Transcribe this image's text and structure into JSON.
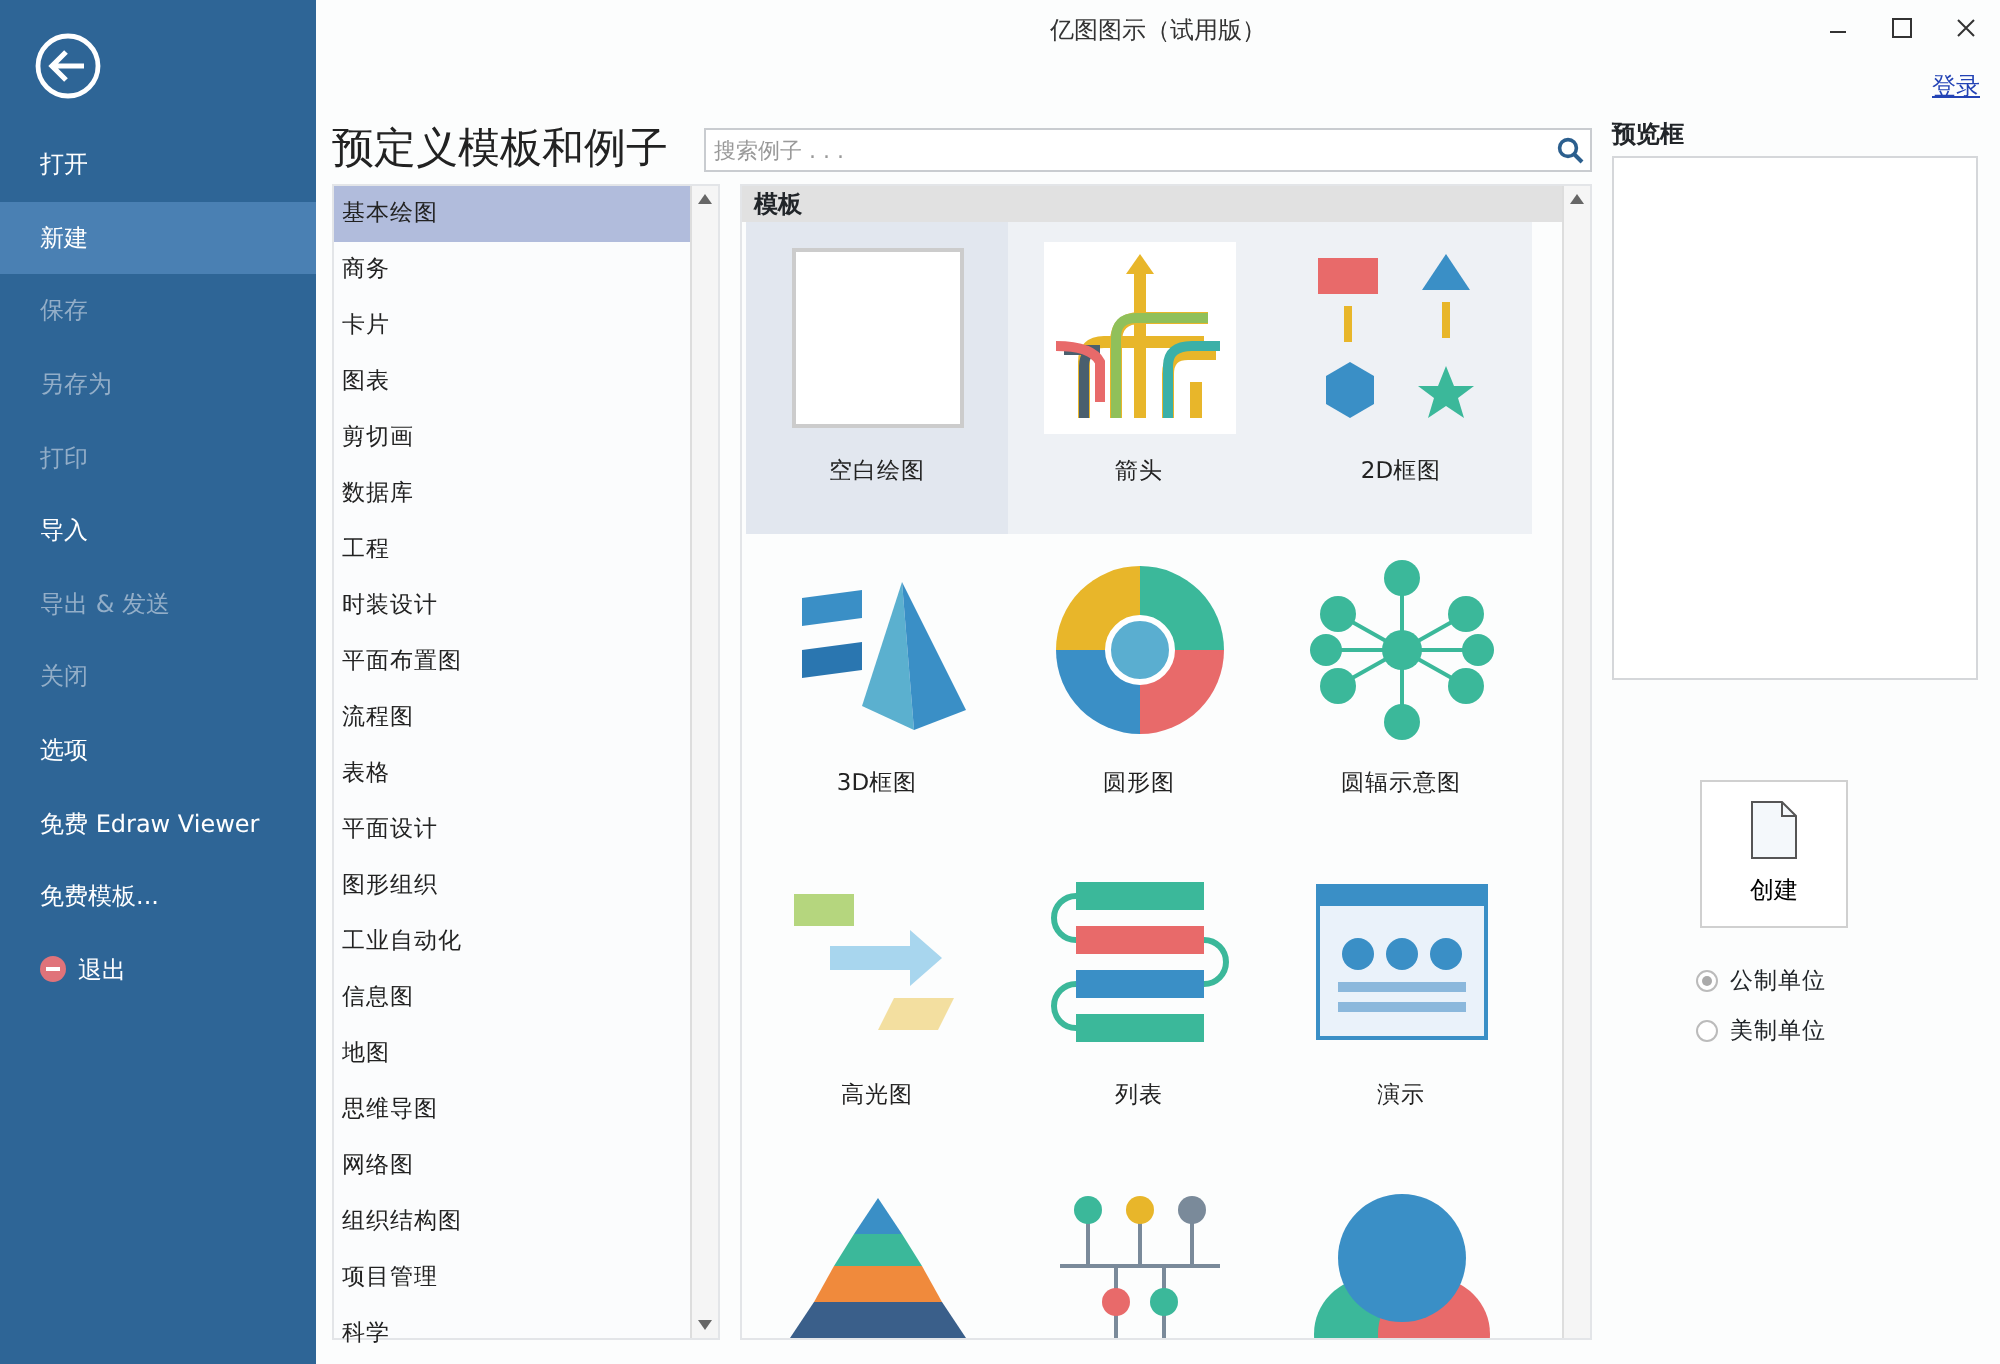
{
  "window": {
    "title": "亿图图示（试用版）",
    "login": "登录"
  },
  "menu": [
    {
      "label": "打开",
      "disabled": false,
      "selected": false
    },
    {
      "label": "新建",
      "disabled": false,
      "selected": true
    },
    {
      "label": "保存",
      "disabled": true,
      "selected": false
    },
    {
      "label": "另存为",
      "disabled": true,
      "selected": false
    },
    {
      "label": "打印",
      "disabled": true,
      "selected": false
    },
    {
      "label": "导入",
      "disabled": false,
      "selected": false
    },
    {
      "label": "导出 & 发送",
      "disabled": true,
      "selected": false
    },
    {
      "label": "关闭",
      "disabled": true,
      "selected": false
    },
    {
      "label": "选项",
      "disabled": false,
      "selected": false
    },
    {
      "label": "免费 Edraw Viewer",
      "disabled": false,
      "selected": false
    },
    {
      "label": "免费模板...",
      "disabled": false,
      "selected": false
    },
    {
      "label": "退出",
      "disabled": false,
      "selected": false,
      "kind": "exit"
    }
  ],
  "heading": "预定义模板和例子",
  "search": {
    "placeholder": "搜索例子 . . ."
  },
  "categories": [
    {
      "label": "基本绘图",
      "selected": true
    },
    {
      "label": "商务",
      "selected": false
    },
    {
      "label": "卡片",
      "selected": false
    },
    {
      "label": "图表",
      "selected": false
    },
    {
      "label": "剪切画",
      "selected": false
    },
    {
      "label": "数据库",
      "selected": false
    },
    {
      "label": "工程",
      "selected": false
    },
    {
      "label": "时装设计",
      "selected": false
    },
    {
      "label": "平面布置图",
      "selected": false
    },
    {
      "label": "流程图",
      "selected": false
    },
    {
      "label": "表格",
      "selected": false
    },
    {
      "label": "平面设计",
      "selected": false
    },
    {
      "label": "图形组织",
      "selected": false
    },
    {
      "label": "工业自动化",
      "selected": false
    },
    {
      "label": "信息图",
      "selected": false
    },
    {
      "label": "地图",
      "selected": false
    },
    {
      "label": "思维导图",
      "selected": false
    },
    {
      "label": "网络图",
      "selected": false
    },
    {
      "label": "组织结构图",
      "selected": false
    },
    {
      "label": "项目管理",
      "selected": false
    },
    {
      "label": "科学",
      "selected": false
    }
  ],
  "templates": {
    "header": "模板",
    "items": [
      {
        "label": "空白绘图",
        "kind": "blank",
        "selected": true
      },
      {
        "label": "箭头",
        "kind": "arrows",
        "selected": false
      },
      {
        "label": "2D框图",
        "kind": "shapes2d",
        "selected": false
      },
      {
        "label": "3D框图",
        "kind": "shapes3d",
        "selected": false
      },
      {
        "label": "圆形图",
        "kind": "circle",
        "selected": false
      },
      {
        "label": "圆辐示意图",
        "kind": "radial",
        "selected": false
      },
      {
        "label": "高光图",
        "kind": "highlight",
        "selected": false
      },
      {
        "label": "列表",
        "kind": "list",
        "selected": false
      },
      {
        "label": "演示",
        "kind": "presentation",
        "selected": false
      },
      {
        "kind": "pyramid",
        "selected": false
      },
      {
        "kind": "timeline",
        "selected": false
      },
      {
        "kind": "venn",
        "selected": false
      }
    ]
  },
  "preview": {
    "title": "预览框"
  },
  "create_button": "创建",
  "units": [
    {
      "label": "公制单位",
      "selected": true
    },
    {
      "label": "美制单位",
      "selected": false
    }
  ]
}
